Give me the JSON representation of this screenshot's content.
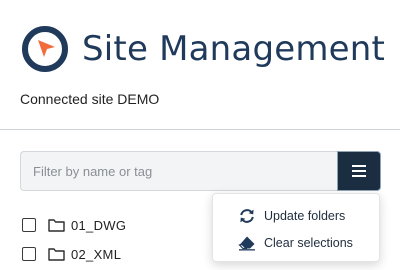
{
  "app": {
    "title": "Site Management",
    "logo_icon": "compass-icon",
    "brand_color": "#1f3a5a",
    "accent_color": "#f26b3a"
  },
  "site": {
    "status": "Connected site DEMO"
  },
  "filter": {
    "placeholder": "Filter by name or tag",
    "value": ""
  },
  "menu_button": {
    "icon": "hamburger-menu-icon"
  },
  "folders": [
    {
      "label": "01_DWG",
      "checked": false,
      "icon": "folder-icon"
    },
    {
      "label": "02_XML",
      "checked": false,
      "icon": "folder-icon"
    }
  ],
  "menu": {
    "items": [
      {
        "label": "Update folders",
        "icon": "refresh-icon"
      },
      {
        "label": "Clear selections",
        "icon": "eraser-icon"
      }
    ]
  }
}
